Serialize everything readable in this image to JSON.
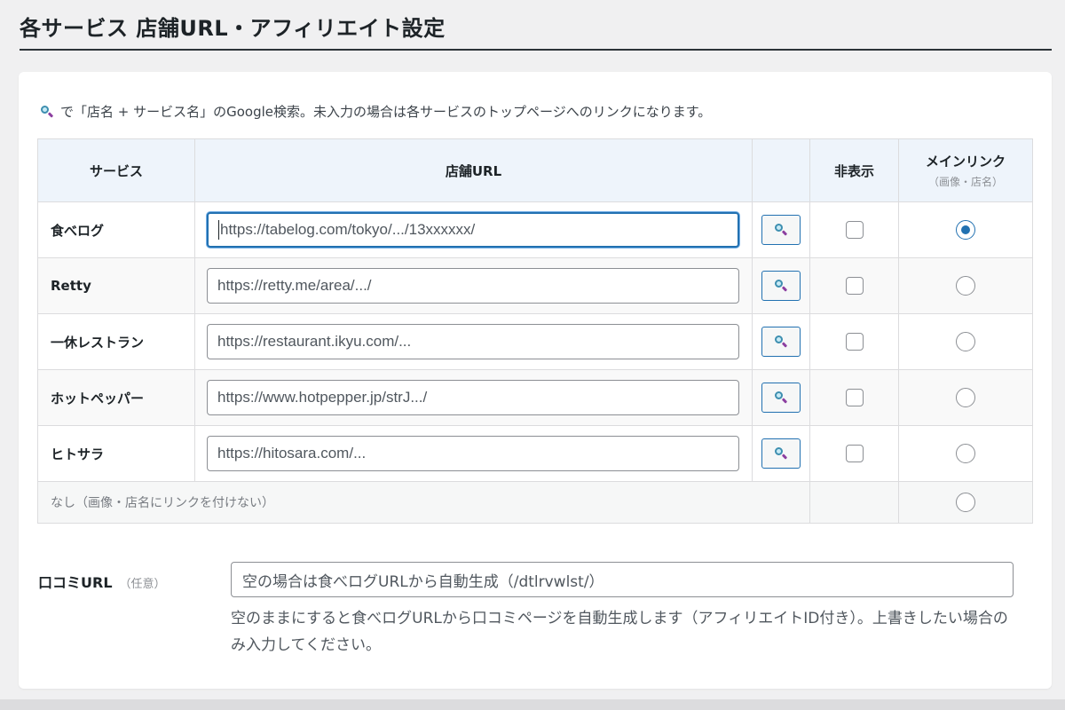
{
  "page_title": "各サービス 店舗URL・アフィリエイト設定",
  "hint": "で「店名 + サービス名」のGoogle検索。未入力の場合は各サービスのトップページへのリンクになります。",
  "table": {
    "headers": {
      "service": "サービス",
      "url": "店舗URL",
      "hide": "非表示",
      "main_link": "メインリンク",
      "main_link_sub": "（画像・店名）"
    },
    "rows": [
      {
        "name": "食べログ",
        "placeholder": "https://tabelog.com/tokyo/.../13xxxxxx/",
        "hidden": false,
        "main": true,
        "focused": true
      },
      {
        "name": "Retty",
        "placeholder": "https://retty.me/area/.../",
        "hidden": false,
        "main": false
      },
      {
        "name": "一休レストラン",
        "placeholder": "https://restaurant.ikyu.com/...",
        "hidden": false,
        "main": false
      },
      {
        "name": "ホットペッパー",
        "placeholder": "https://www.hotpepper.jp/strJ.../",
        "hidden": false,
        "main": false
      },
      {
        "name": "ヒトサラ",
        "placeholder": "https://hitosara.com/...",
        "hidden": false,
        "main": false
      }
    ],
    "none_label": "なし（画像・店名にリンクを付けない）"
  },
  "kuchikomi": {
    "label": "口コミURL",
    "optional": "（任意）",
    "placeholder": "空の場合は食べログURLから自動生成（/dtlrvwlst/）",
    "description": "空のままにすると食べログURLから口コミページを自動生成します（アフィリエイトID付き）。上書きしたい場合のみ入力してください。"
  },
  "colors": {
    "accent": "#2271b1",
    "header_bg": "#eef4fb",
    "page_bg": "#f0f0f1"
  }
}
